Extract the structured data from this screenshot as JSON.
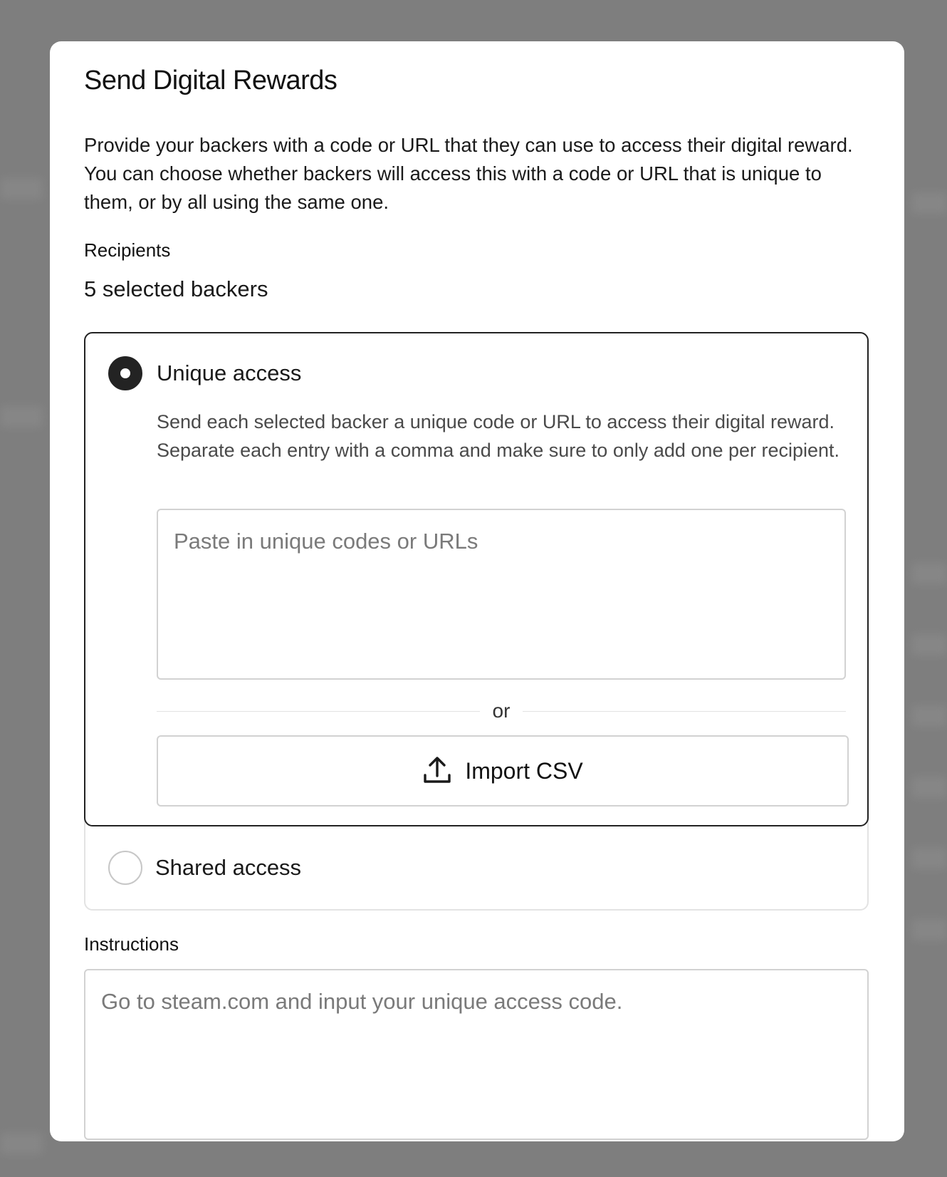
{
  "modal": {
    "title": "Send Digital Rewards",
    "intro": "Provide your backers with a code or URL that they can use to access their digital reward. You can choose whether backers will access this with a code or URL that is unique to them, or by all using the same one."
  },
  "recipients": {
    "label": "Recipients",
    "value": "5 selected backers"
  },
  "access_options": {
    "selected": "unique",
    "unique": {
      "label": "Unique access",
      "description": "Send each selected backer a unique code or URL to access their digital reward. Separate each entry with a comma and make sure to only add one per recipient.",
      "codes_placeholder": "Paste in unique codes or URLs",
      "codes_value": "",
      "divider_text": "or",
      "import_button_label": "Import CSV",
      "import_icon": "upload-icon"
    },
    "shared": {
      "label": "Shared access"
    }
  },
  "instructions": {
    "label": "Instructions",
    "placeholder": "Go to steam.com and input your unique access code.",
    "value": ""
  },
  "colors": {
    "overlay": "#7e7e7e",
    "modal_bg": "#ffffff",
    "selected_border": "#222222",
    "radio_checked": "#232323"
  }
}
